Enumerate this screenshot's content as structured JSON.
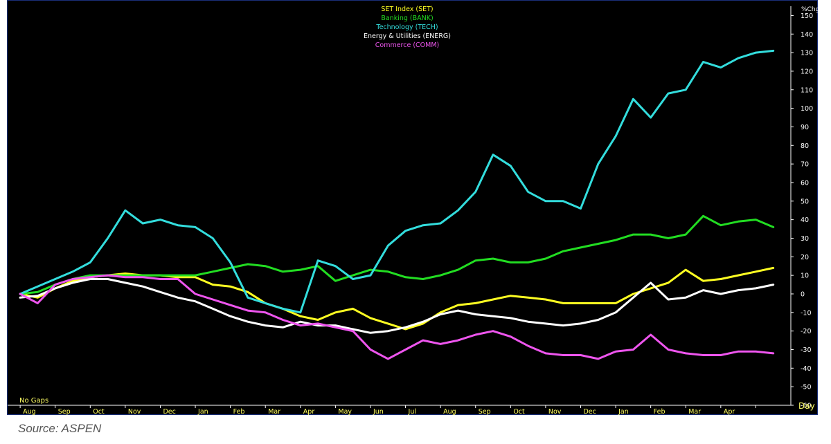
{
  "source": "Source: ASPEN",
  "chart_data": {
    "type": "line",
    "ylabel": "%Chg",
    "xlabel": "Day",
    "footer_note": "No Gaps",
    "ylim": [
      -60,
      155
    ],
    "yticks": [
      150,
      140,
      130,
      120,
      110,
      100,
      90,
      80,
      70,
      60,
      50,
      40,
      30,
      20,
      10,
      0,
      -10,
      -20,
      -30,
      -40,
      -50,
      -60
    ],
    "ytick_labels": [
      "150",
      "140",
      "130",
      "120",
      "110",
      "100",
      "90",
      "80",
      "70",
      "60",
      "50",
      "40",
      "30",
      "20",
      "10",
      "0",
      "-10",
      "-20",
      "-30",
      "-40",
      "-50",
      "-60"
    ],
    "x_ticks": [
      "Aug",
      "Sep",
      "Oct",
      "Nov",
      "Dec",
      "Jan",
      "Feb",
      "Mar",
      "Apr",
      "May",
      "Jun",
      "Jul",
      "Aug",
      "Sep",
      "Oct",
      "Nov",
      "Dec",
      "Jan",
      "Feb",
      "Mar",
      "Apr"
    ],
    "x_tick_positions": [
      0.5,
      1.5,
      2.5,
      3.5,
      4.5,
      5.5,
      6.5,
      7.5,
      8.5,
      9.5,
      10.5,
      11.5,
      12.5,
      13.5,
      14.5,
      15.5,
      16.5,
      17.5,
      18.5,
      19.5,
      20.5
    ],
    "xlim": [
      -0.2,
      22.0
    ],
    "grid": false,
    "legend_placement": "top-center",
    "colors": {
      "background": "#000000",
      "axis": "#ffffff",
      "x_tick_text": "#ffff66",
      "y_tick_text": "#ffffff"
    },
    "series": [
      {
        "name": "SET Index (SET)",
        "color": "#ffff22",
        "x": [
          0,
          0.5,
          1,
          1.5,
          2,
          2.5,
          3,
          3.5,
          4,
          4.5,
          5,
          5.5,
          6,
          6.5,
          7,
          7.5,
          8,
          8.5,
          9,
          9.5,
          10,
          10.5,
          11,
          11.5,
          12,
          12.5,
          13,
          13.5,
          14,
          14.5,
          15,
          15.5,
          16,
          16.5,
          17,
          17.5,
          18,
          18.5,
          19,
          19.5,
          20,
          20.5,
          21,
          21.5
        ],
        "values": [
          0,
          -2,
          3,
          7,
          9,
          10,
          11,
          10,
          10,
          9,
          9,
          5,
          4,
          1,
          -5,
          -8,
          -12,
          -14,
          -10,
          -8,
          -13,
          -16,
          -19,
          -16,
          -10,
          -6,
          -5,
          -3,
          -1,
          -2,
          -3,
          -5,
          -5,
          -5,
          -5,
          0,
          3,
          6,
          13,
          7,
          8,
          10,
          12,
          14
        ]
      },
      {
        "name": "Banking (BANK)",
        "color": "#22dd22",
        "x": [
          0,
          0.5,
          1,
          1.5,
          2,
          2.5,
          3,
          3.5,
          4,
          4.5,
          5,
          5.5,
          6,
          6.5,
          7,
          7.5,
          8,
          8.5,
          9,
          9.5,
          10,
          10.5,
          11,
          11.5,
          12,
          12.5,
          13,
          13.5,
          14,
          14.5,
          15,
          15.5,
          16,
          16.5,
          17,
          17.5,
          18,
          18.5,
          19,
          19.5,
          20,
          20.5,
          21,
          21.5
        ],
        "values": [
          0,
          1,
          5,
          8,
          10,
          10,
          10,
          10,
          10,
          10,
          10,
          12,
          14,
          16,
          15,
          12,
          13,
          15,
          7,
          10,
          13,
          12,
          9,
          8,
          10,
          13,
          18,
          19,
          17,
          17,
          19,
          23,
          25,
          27,
          29,
          32,
          32,
          30,
          32,
          42,
          37,
          39,
          40,
          36
        ]
      },
      {
        "name": "Technology (TECH)",
        "color": "#33dddd",
        "x": [
          0,
          0.5,
          1,
          1.5,
          2,
          2.5,
          3,
          3.5,
          4,
          4.5,
          5,
          5.5,
          6,
          6.5,
          7,
          7.5,
          8,
          8.5,
          9,
          9.5,
          10,
          10.5,
          11,
          11.5,
          12,
          12.5,
          13,
          13.5,
          14,
          14.5,
          15,
          15.5,
          16,
          16.5,
          17,
          17.5,
          18,
          18.5,
          19,
          19.5,
          20,
          20.5,
          21,
          21.5
        ],
        "values": [
          0,
          4,
          8,
          12,
          17,
          30,
          45,
          38,
          40,
          37,
          36,
          30,
          17,
          -2,
          -5,
          -8,
          -10,
          18,
          15,
          8,
          10,
          26,
          34,
          37,
          38,
          45,
          55,
          75,
          69,
          55,
          50,
          50,
          46,
          70,
          85,
          105,
          95,
          108,
          110,
          125,
          122,
          127,
          130,
          131
        ]
      },
      {
        "name": "Energy & Utilities (ENERG)",
        "color": "#ffffff",
        "x": [
          0,
          0.5,
          1,
          1.5,
          2,
          2.5,
          3,
          3.5,
          4,
          4.5,
          5,
          5.5,
          6,
          6.5,
          7,
          7.5,
          8,
          8.5,
          9,
          9.5,
          10,
          10.5,
          11,
          11.5,
          12,
          12.5,
          13,
          13.5,
          14,
          14.5,
          15,
          15.5,
          16,
          16.5,
          17,
          17.5,
          18,
          18.5,
          19,
          19.5,
          20,
          20.5,
          21,
          21.5
        ],
        "values": [
          -2,
          -1,
          3,
          6,
          8,
          8,
          6,
          4,
          1,
          -2,
          -4,
          -8,
          -12,
          -15,
          -17,
          -18,
          -15,
          -17,
          -17,
          -19,
          -21,
          -20,
          -18,
          -15,
          -11,
          -9,
          -11,
          -12,
          -13,
          -15,
          -16,
          -17,
          -16,
          -14,
          -10,
          -2,
          6,
          -3,
          -2,
          2,
          0,
          2,
          3,
          5
        ]
      },
      {
        "name": "Commerce (COMM)",
        "color": "#ee55ee",
        "x": [
          0,
          0.5,
          1,
          1.5,
          2,
          2.5,
          3,
          3.5,
          4,
          4.5,
          5,
          5.5,
          6,
          6.5,
          7,
          7.5,
          8,
          8.5,
          9,
          9.5,
          10,
          10.5,
          11,
          11.5,
          12,
          12.5,
          13,
          13.5,
          14,
          14.5,
          15,
          15.5,
          16,
          16.5,
          17,
          17.5,
          18,
          18.5,
          19,
          19.5,
          20,
          20.5,
          21,
          21.5
        ],
        "values": [
          0,
          -5,
          5,
          8,
          9,
          10,
          9,
          9,
          8,
          8,
          0,
          -3,
          -6,
          -9,
          -10,
          -14,
          -17,
          -16,
          -18,
          -20,
          -30,
          -35,
          -30,
          -25,
          -27,
          -25,
          -22,
          -20,
          -23,
          -28,
          -32,
          -33,
          -33,
          -35,
          -31,
          -30,
          -22,
          -30,
          -32,
          -33,
          -33,
          -31,
          -31,
          -32
        ]
      }
    ]
  }
}
